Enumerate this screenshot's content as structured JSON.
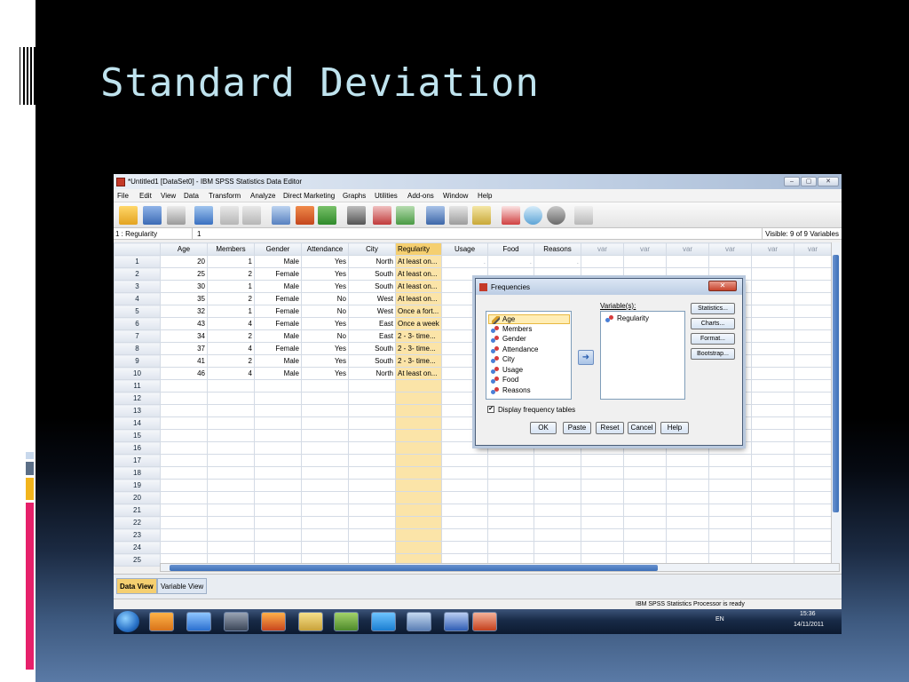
{
  "slide": {
    "title": "Standard Deviation"
  },
  "window": {
    "title": "*Untitled1 [DataSet0] - IBM SPSS Statistics Data Editor",
    "controls": [
      "–",
      "▢",
      "✕"
    ]
  },
  "menu": [
    "File",
    "Edit",
    "View",
    "Data",
    "Transform",
    "Analyze",
    "Direct Marketing",
    "Graphs",
    "Utilities",
    "Add-ons",
    "Window",
    "Help"
  ],
  "toolbar": {
    "icons": [
      "open-icon",
      "save-icon",
      "print-icon",
      "dialog-recall-icon",
      "undo-icon",
      "redo-icon",
      "goto-case-icon",
      "goto-variable-icon",
      "variables-icon",
      "find-icon",
      "insert-cases-icon",
      "insert-variable-icon",
      "split-file-icon",
      "weight-cases-icon",
      "select-cases-icon",
      "value-labels-icon",
      "use-sets-icon",
      "show-all-icon",
      "spell-check-icon"
    ]
  },
  "cell_editor": {
    "reference": "1 : Regularity",
    "value": "1",
    "visible": "Visible: 9 of 9 Variables"
  },
  "grid": {
    "columns": [
      "Age",
      "Members",
      "Gender",
      "Attendance",
      "City",
      "Regularity",
      "Usage",
      "Food",
      "Reasons",
      "var",
      "var",
      "var",
      "var",
      "var",
      "var"
    ],
    "rows": [
      {
        "n": "1",
        "cells": [
          "20",
          "1",
          "Male",
          "Yes",
          "North",
          "At least on...",
          ".",
          ".",
          "."
        ]
      },
      {
        "n": "2",
        "cells": [
          "25",
          "2",
          "Female",
          "Yes",
          "South",
          "At least on...",
          "",
          "",
          ""
        ]
      },
      {
        "n": "3",
        "cells": [
          "30",
          "1",
          "Male",
          "Yes",
          "South",
          "At least on...",
          "",
          "",
          ""
        ]
      },
      {
        "n": "4",
        "cells": [
          "35",
          "2",
          "Female",
          "No",
          "West",
          "At least on...",
          "",
          "",
          ""
        ]
      },
      {
        "n": "5",
        "cells": [
          "32",
          "1",
          "Female",
          "No",
          "West",
          "Once a fort...",
          "",
          "",
          ""
        ]
      },
      {
        "n": "6",
        "cells": [
          "43",
          "4",
          "Female",
          "Yes",
          "East",
          "Once a week",
          "",
          "",
          ""
        ]
      },
      {
        "n": "7",
        "cells": [
          "34",
          "2",
          "Male",
          "No",
          "East",
          "2 - 3- time...",
          "",
          "",
          ""
        ]
      },
      {
        "n": "8",
        "cells": [
          "37",
          "4",
          "Female",
          "Yes",
          "South",
          "2 - 3- time...",
          "",
          "",
          ""
        ]
      },
      {
        "n": "9",
        "cells": [
          "41",
          "2",
          "Male",
          "Yes",
          "South",
          "2 - 3- time...",
          "",
          "",
          ""
        ]
      },
      {
        "n": "10",
        "cells": [
          "46",
          "4",
          "Male",
          "Yes",
          "North",
          "At least on...",
          "",
          "",
          ""
        ]
      },
      {
        "n": "11",
        "cells": []
      },
      {
        "n": "12",
        "cells": []
      },
      {
        "n": "13",
        "cells": []
      },
      {
        "n": "14",
        "cells": []
      },
      {
        "n": "15",
        "cells": []
      },
      {
        "n": "16",
        "cells": []
      },
      {
        "n": "17",
        "cells": []
      },
      {
        "n": "18",
        "cells": []
      },
      {
        "n": "19",
        "cells": []
      },
      {
        "n": "20",
        "cells": []
      },
      {
        "n": "21",
        "cells": []
      },
      {
        "n": "22",
        "cells": []
      },
      {
        "n": "23",
        "cells": []
      },
      {
        "n": "24",
        "cells": []
      },
      {
        "n": "25",
        "cells": []
      }
    ]
  },
  "tabs": {
    "data_view": "Data View",
    "variable_view": "Variable View"
  },
  "status": {
    "processor": "IBM SPSS Statistics Processor is ready"
  },
  "dialog": {
    "title": "Frequencies",
    "close": "✕",
    "source_variables": [
      "Age",
      "Members",
      "Gender",
      "Attendance",
      "City",
      "Usage",
      "Food",
      "Reasons"
    ],
    "variables_label": "Variable(s):",
    "selected_variables": [
      "Regularity"
    ],
    "side_buttons": [
      "Statistics...",
      "Charts...",
      "Format...",
      "Bootstrap..."
    ],
    "checkbox_label": "Display frequency tables",
    "checkbox_checked": true,
    "bottom_buttons": [
      "OK",
      "Paste",
      "Reset",
      "Cancel",
      "Help"
    ]
  },
  "taskbar": {
    "apps": [
      "start-orb-icon",
      "media-player-icon",
      "internet-explorer-icon",
      "hp-icon",
      "firefox-icon",
      "explorer-folder-icon",
      "games-icon",
      "skype-icon",
      "spss-icon",
      "word-icon",
      "powerpoint-icon"
    ],
    "language": "EN",
    "time": "15:36",
    "date": "14/11/2011"
  },
  "colors": {
    "title_text": "#bfe3ee",
    "regularity_highlight": "#fbe4a8",
    "accent_bars": [
      "#c8d8ec",
      "#5b6e86",
      "#f2b41c",
      "#e6206a"
    ]
  }
}
